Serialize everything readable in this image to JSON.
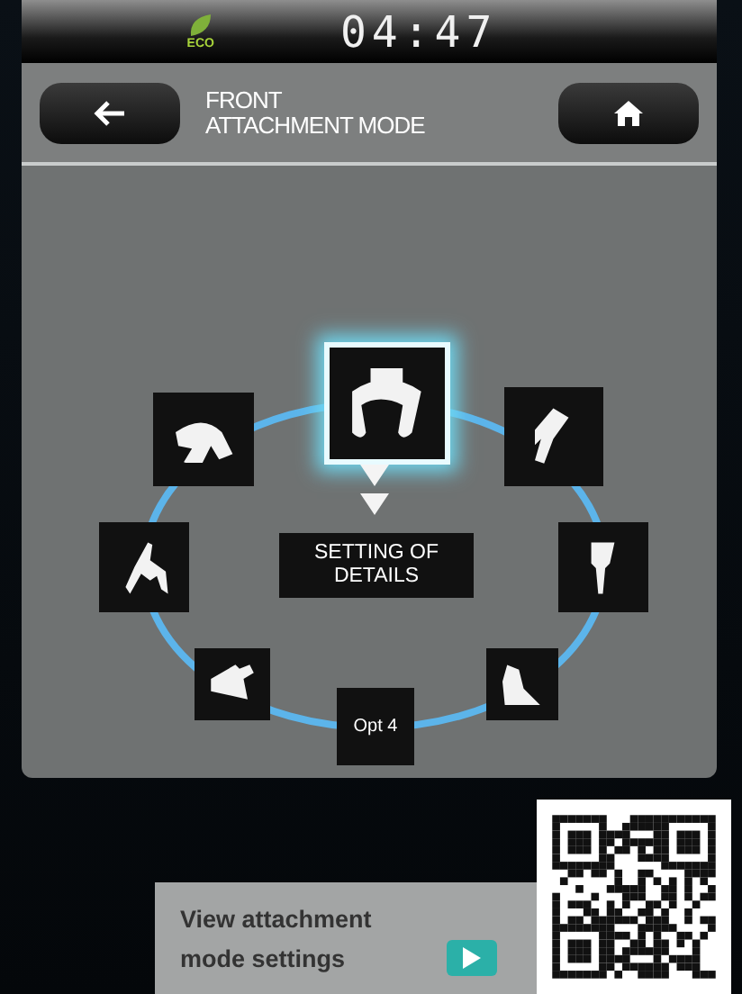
{
  "status_bar": {
    "eco_label": "ECO",
    "time": "04:47"
  },
  "header": {
    "title_lines": [
      "FRONT",
      "ATTACHMENT MODE"
    ]
  },
  "attachments": [
    {
      "kind": "icon",
      "selected": true
    },
    {
      "kind": "icon",
      "selected": false
    },
    {
      "kind": "icon",
      "selected": false
    },
    {
      "kind": "icon",
      "selected": false
    },
    {
      "kind": "label",
      "label": "Opt 4",
      "selected": false
    },
    {
      "kind": "icon",
      "selected": false
    },
    {
      "kind": "icon",
      "selected": false
    },
    {
      "kind": "icon",
      "selected": false
    }
  ],
  "details_button": {
    "label": "SETTING OF DETAILS"
  },
  "promo": {
    "text": "View attachment mode settings"
  }
}
